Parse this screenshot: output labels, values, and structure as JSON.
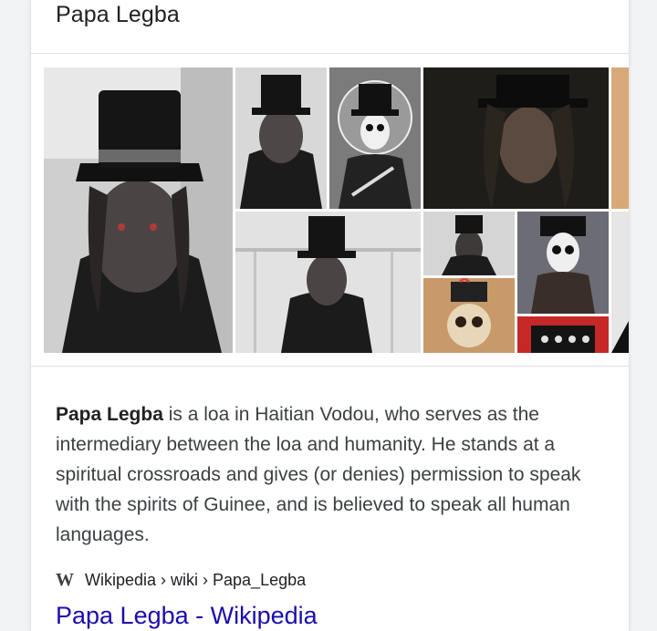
{
  "panel": {
    "title": "Papa Legba"
  },
  "images": [
    {
      "name": "image-1",
      "alt": "Papa Legba top hat portrait"
    },
    {
      "name": "image-2",
      "alt": "Papa Legba small portrait"
    },
    {
      "name": "image-3",
      "alt": "Skull figure illustration"
    },
    {
      "name": "image-4",
      "alt": "Papa Legba dark portrait"
    },
    {
      "name": "image-5",
      "alt": "Cropped image"
    },
    {
      "name": "image-6",
      "alt": "Papa Legba in building"
    },
    {
      "name": "image-7",
      "alt": "Papa Legba small"
    },
    {
      "name": "image-8",
      "alt": "Skull costume"
    },
    {
      "name": "image-9",
      "alt": "Skull painting"
    },
    {
      "name": "image-10",
      "alt": "Hat detail"
    },
    {
      "name": "image-11",
      "alt": "Cropped image"
    }
  ],
  "description": {
    "term": "Papa Legba",
    "text": " is a loa in Haitian Vodou, who serves as the intermediary between the loa and humanity. He stands at a spiritual crossroads and gives (or denies) permission to speak with the spirits of Guinee, and is believed to speak all human languages."
  },
  "source": {
    "icon": "W",
    "breadcrumb": "Wikipedia › wiki › Papa_Legba"
  },
  "link": {
    "text": "Papa Legba - Wikipedia"
  },
  "colors": {
    "link": "#1a0dab",
    "text": "#3c4043",
    "title": "#202124"
  }
}
